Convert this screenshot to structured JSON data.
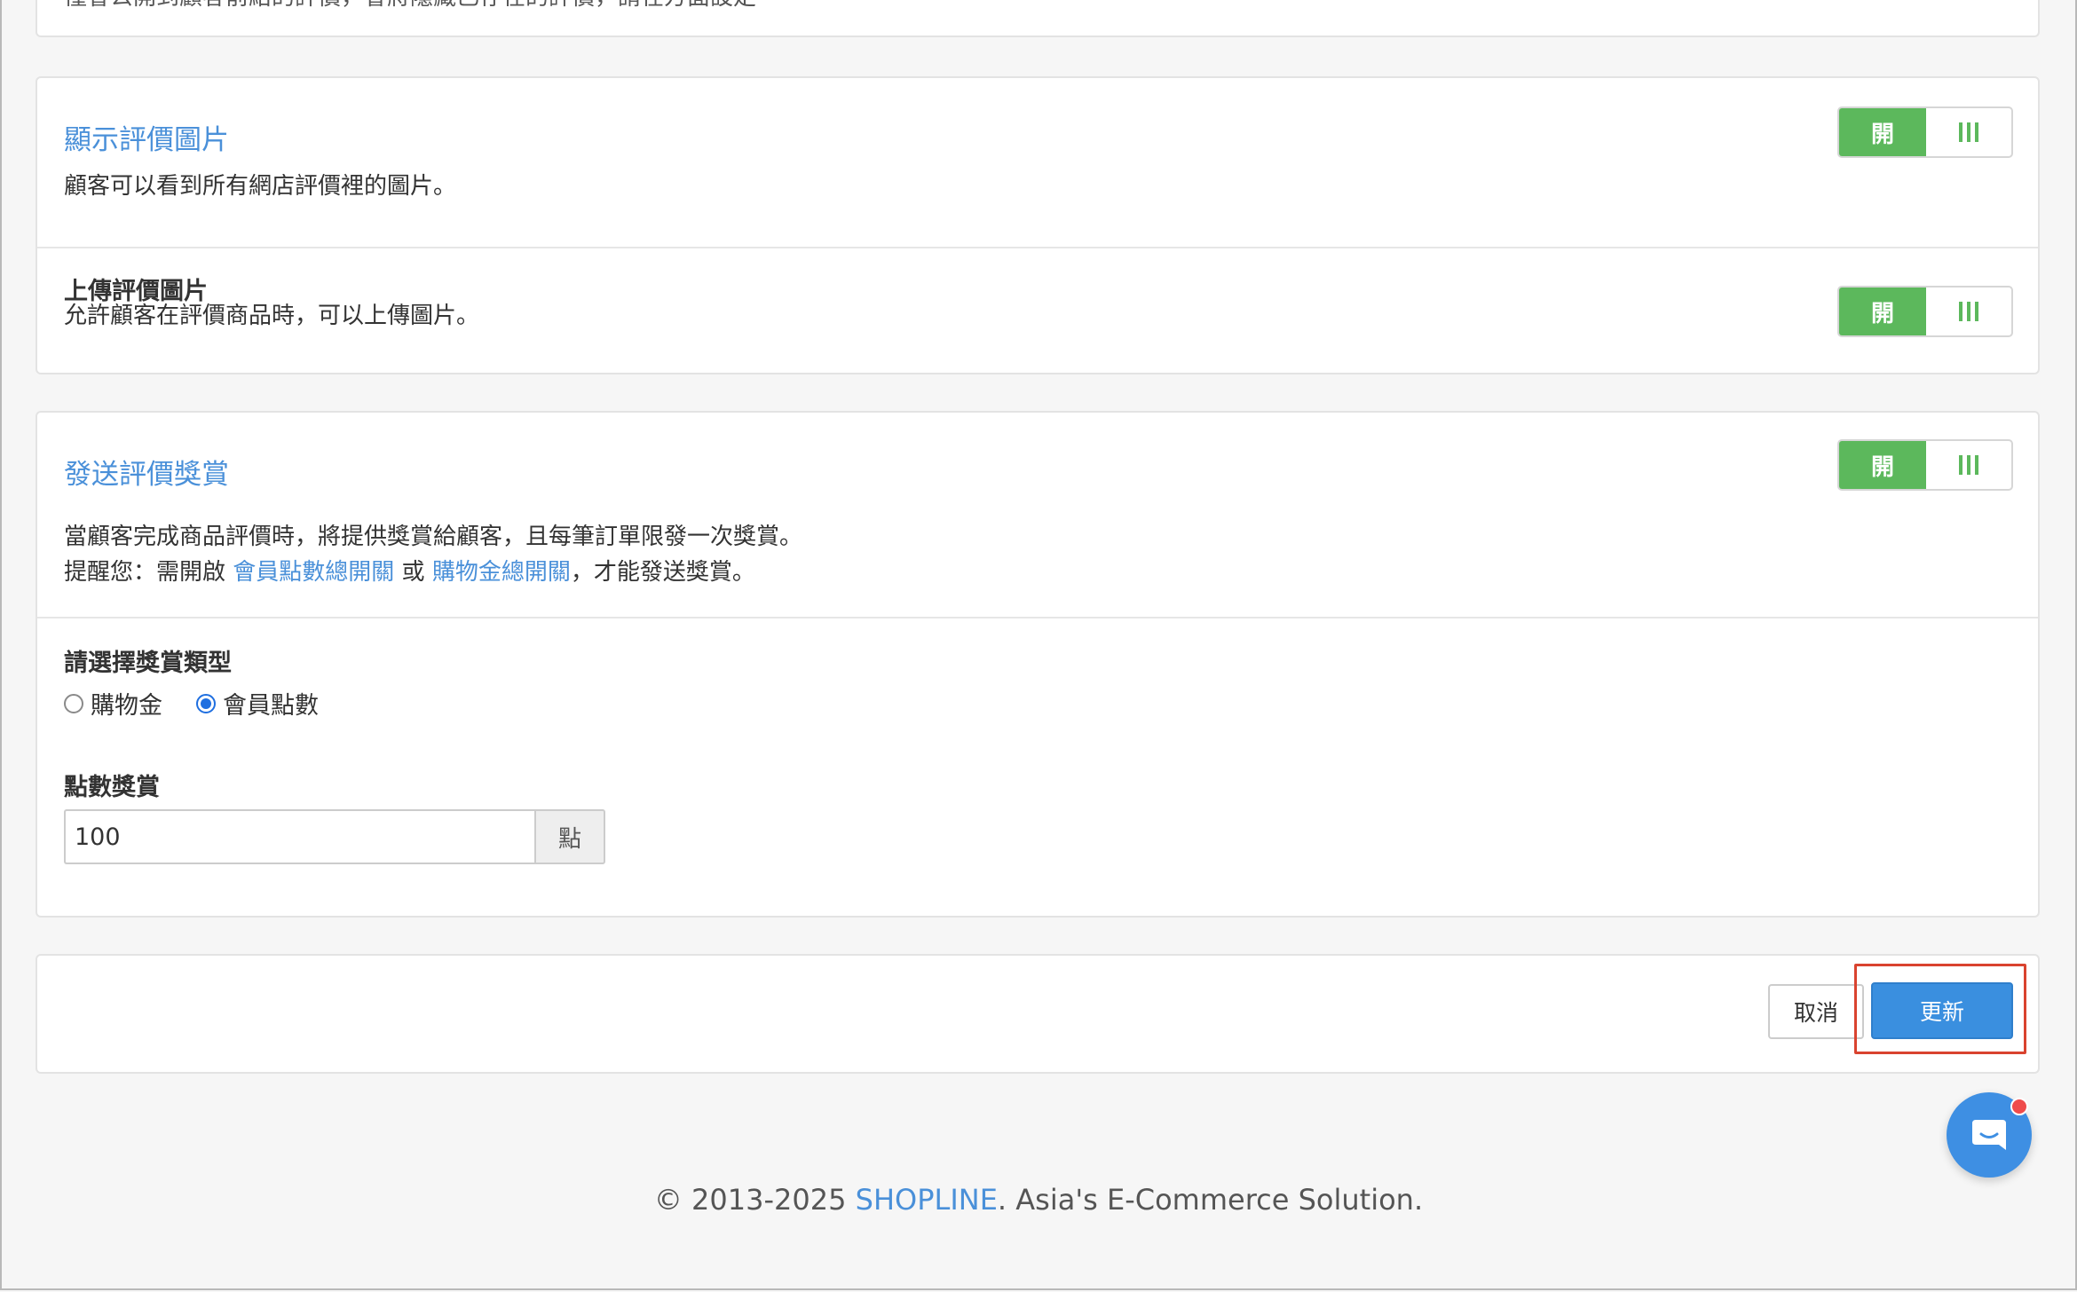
{
  "top_strip": {
    "cut_text": "僅會公開到顧客前給的評價，會將隱藏已存在的評價，請在方面設定"
  },
  "display_review_images": {
    "title": "顯示評價圖片",
    "description": "顧客可以看到所有網店評價裡的圖片。",
    "toggle": {
      "on_label": "開",
      "state": "on"
    }
  },
  "upload_review_images": {
    "title": "上傳評價圖片",
    "description": "允許顧客在評價商品時，可以上傳圖片。",
    "toggle": {
      "on_label": "開",
      "state": "on"
    }
  },
  "review_reward": {
    "title": "發送評價獎賞",
    "description_line1": "當顧客完成商品評價時，將提供獎賞給顧客，且每筆訂單限發一次獎賞。",
    "reminder_prefix": "提醒您：需開啟 ",
    "link_member_points": "會員點數總開關",
    "reminder_or": " 或 ",
    "link_store_credit": "購物金總開關",
    "reminder_suffix": "，才能發送獎賞。",
    "toggle": {
      "on_label": "開",
      "state": "on"
    },
    "reward_type_label": "請選擇獎賞類型",
    "reward_options": [
      {
        "label": "購物金",
        "checked": false
      },
      {
        "label": "會員點數",
        "checked": true
      }
    ],
    "points_label": "點數獎賞",
    "points_value": "100",
    "points_unit": "點"
  },
  "actions": {
    "cancel_label": "取消",
    "update_label": "更新"
  },
  "footer": {
    "prefix": "© 2013-2025 ",
    "brand": "SHOPLINE",
    "suffix": ". Asia's E-Commerce Solution."
  },
  "colors": {
    "accent_blue": "#4a90d9",
    "toggle_green": "#5cb85c",
    "primary_button": "#3a8fdf",
    "highlight_red": "#d9432f"
  }
}
